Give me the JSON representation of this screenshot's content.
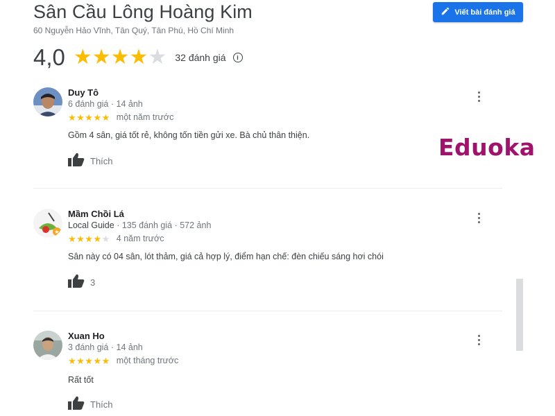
{
  "header": {
    "place_name": "Sân Cầu Lông Hoàng Kim",
    "address": "60 Nguyễn Hảo Vĩnh, Tân Quý, Tân Phú, Hồ Chí Minh",
    "write_review_label": "Viết bài đánh giá",
    "write_icon": "pencil-icon"
  },
  "summary": {
    "rating": "4,0",
    "stars_filled": 4,
    "stars_total": 5,
    "review_count": "32 đánh giá",
    "info_icon": "info-icon"
  },
  "reviews": [
    {
      "author": "Duy Tô",
      "guide": "",
      "stats": "6 đánh giá · 14 ảnh",
      "stars": "★★★★★",
      "stars_off": "",
      "time": "một năm trước",
      "text": "Gồm 4 sân, giá tốt rẻ, không tốn tiền gửi xe. Bà chủ thân thiện.",
      "like_label": "Thích"
    },
    {
      "author": "Mầm Chồi Lá",
      "guide": "Local Guide",
      "stats": " · 135 đánh giá · 572 ảnh",
      "stars": "★★★★",
      "stars_off": "★",
      "time": "4 năm trước",
      "text": "Sân này có 04 sân, lót thảm, giá cả hợp lý, điểm hạn chế: đèn chiếu sáng hơi chói",
      "like_label": "3"
    },
    {
      "author": "Xuan Ho",
      "guide": "",
      "stats": "3 đánh giá · 14 ảnh",
      "stars": "★★★★★",
      "stars_off": "",
      "time": "một tháng trước",
      "text": "Rất tốt",
      "like_label": "Thích"
    }
  ],
  "watermark": "Eduoka",
  "colors": {
    "accent": "#1a73e8",
    "star": "#fbbc04",
    "star_empty": "#dadce0",
    "watermark": "#a0136c"
  }
}
